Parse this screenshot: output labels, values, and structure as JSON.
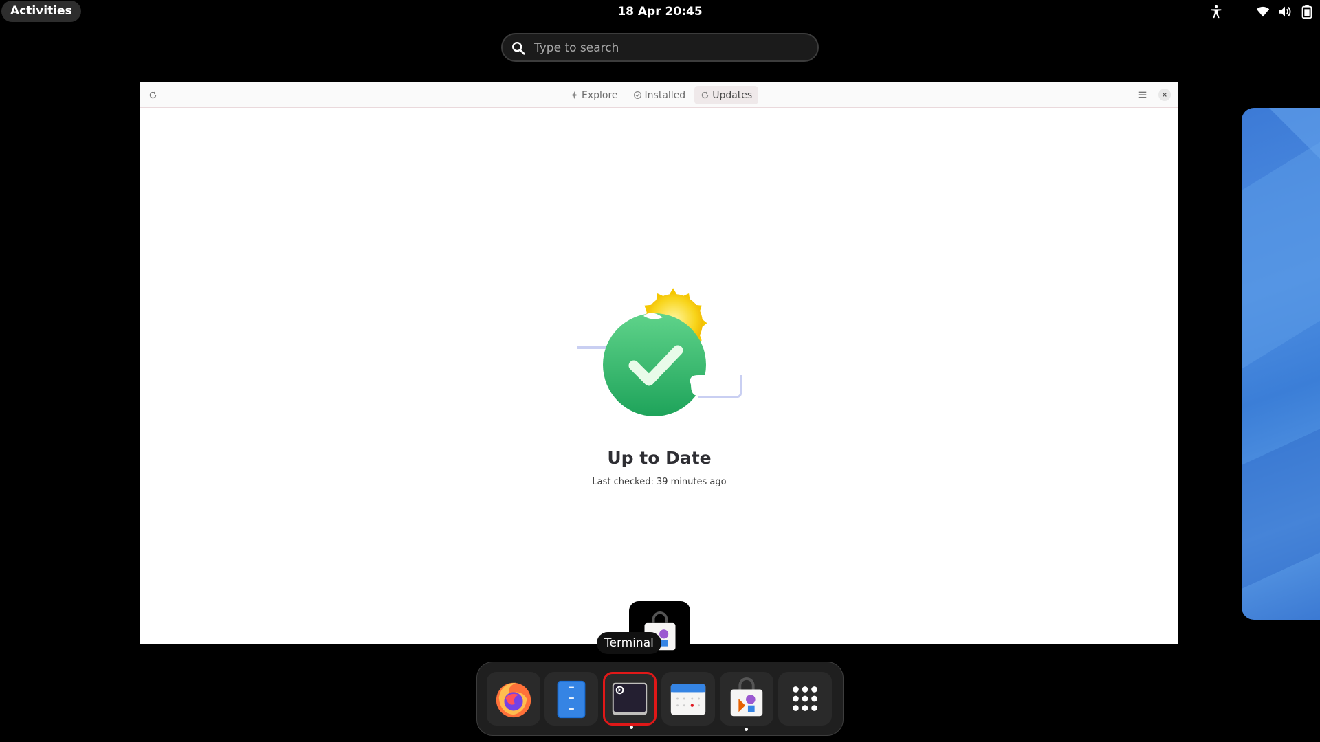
{
  "topbar": {
    "activities_label": "Activities",
    "clock": "18 Apr  20:45",
    "icons": [
      "accessibility-icon",
      "wifi-icon",
      "volume-icon",
      "battery-icon"
    ]
  },
  "search": {
    "placeholder": "Type to search",
    "icon": "search-icon"
  },
  "window": {
    "tabs": [
      {
        "label": "Explore",
        "icon": "explore-icon",
        "active": false
      },
      {
        "label": "Installed",
        "icon": "installed-icon",
        "active": false
      },
      {
        "label": "Updates",
        "icon": "updates-icon",
        "active": true
      }
    ],
    "status_title": "Up to Date",
    "status_subtitle": "Last checked: 39 minutes ago"
  },
  "dash": {
    "apps": [
      {
        "name": "Firefox",
        "icon": "firefox-icon",
        "running": false
      },
      {
        "name": "Files",
        "icon": "files-icon",
        "running": false
      },
      {
        "name": "Terminal",
        "icon": "terminal-icon",
        "running": true
      },
      {
        "name": "Calendar",
        "icon": "calendar-icon",
        "running": false
      },
      {
        "name": "Software",
        "icon": "software-icon",
        "running": true
      },
      {
        "name": "Show Apps",
        "icon": "app-grid-icon",
        "running": false
      }
    ],
    "tooltip": "Terminal"
  },
  "colors": {
    "accent_success": "#2ec27e",
    "highlight_border": "#e01818",
    "workspace_blue": "#3c7ad6"
  }
}
